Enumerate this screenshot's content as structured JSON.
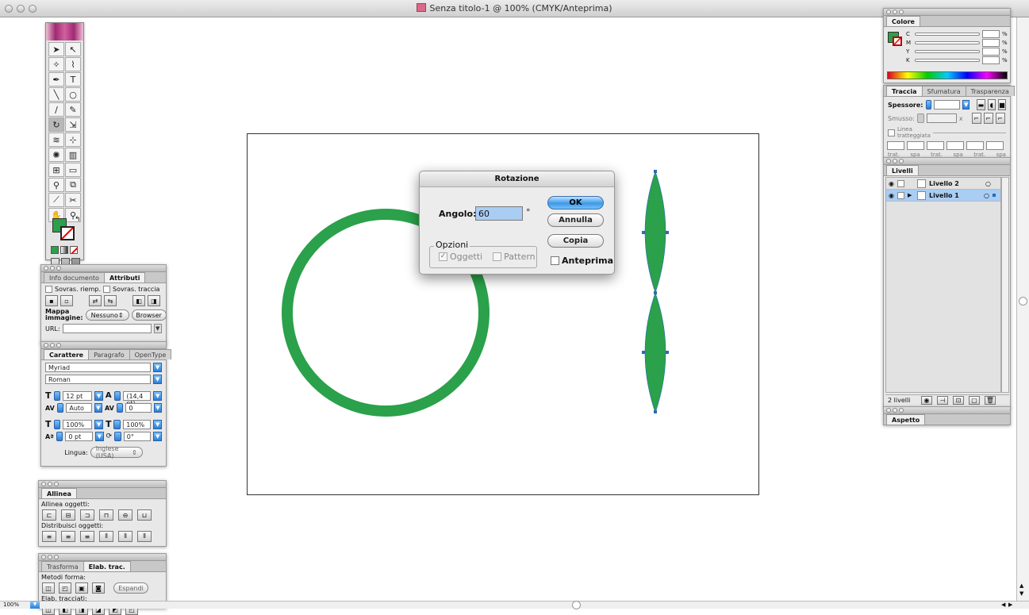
{
  "window": {
    "title": "Senza titolo-1 @ 100% (CMYK/Anteprima)"
  },
  "colors": {
    "green": "#2aa14a",
    "accent": "#3c9ae8"
  },
  "dialog": {
    "title": "Rotazione",
    "angle_label": "Angolo:",
    "angle_value": "60",
    "degree_symbol": "°",
    "options_label": "Opzioni",
    "objects_label": "Oggetti",
    "pattern_label": "Pattern",
    "ok": "OK",
    "cancel": "Annulla",
    "copy": "Copia",
    "preview": "Anteprima"
  },
  "attributes_panel": {
    "tabs": [
      "Info documento",
      "Attributi"
    ],
    "overprint_fill": "Sovras. riemp.",
    "overprint_stroke": "Sovras. traccia",
    "image_map_label_1": "Mappa",
    "image_map_label_2": "immagine:",
    "image_map_value": "Nessuno",
    "browser": "Browser",
    "url_label": "URL:"
  },
  "character_panel": {
    "tabs": [
      "Carattere",
      "Paragrafo",
      "OpenType"
    ],
    "font": "Myriad",
    "style": "Roman",
    "size": "12 pt",
    "leading": "(14,4 pt)",
    "kerning": "Auto",
    "tracking": "0",
    "scale_h": "100%",
    "scale_v": "100%",
    "baseline": "0 pt",
    "rotation": "0°",
    "language_label": "Lingua:",
    "language_value": "Inglese (USA)"
  },
  "align_panel": {
    "tab": "Allinea",
    "align_label": "Allinea oggetti:",
    "distribute_label": "Distribuisci oggetti:"
  },
  "pathfinder_panel": {
    "tabs": [
      "Trasforma",
      "Elab. trac."
    ],
    "shape_label": "Metodi forma:",
    "expand": "Espandi",
    "pathfinders_label": "Elab. tracciati:"
  },
  "color_panel": {
    "tab": "Colore",
    "channels": [
      "C",
      "M",
      "Y",
      "K"
    ],
    "percent": "%"
  },
  "stroke_panel": {
    "tabs": [
      "Traccia",
      "Sfumatura",
      "Trasparenza"
    ],
    "weight_label": "Spessore:",
    "miter_label": "Smusso:",
    "miter_unit": "x",
    "dashed_label_1": "Linea",
    "dashed_label_2": "tratteggiata",
    "dash_labels": [
      "trat.",
      "spa",
      "trat.",
      "spa",
      "trat.",
      "spa"
    ]
  },
  "layers_panel": {
    "tab": "Livelli",
    "layers": [
      {
        "name": "Livello 2"
      },
      {
        "name": "Livello 1"
      }
    ],
    "count": "2 livelli"
  },
  "appearance_panel": {
    "tab": "Aspetto"
  },
  "status": {
    "zoom": "100%"
  }
}
